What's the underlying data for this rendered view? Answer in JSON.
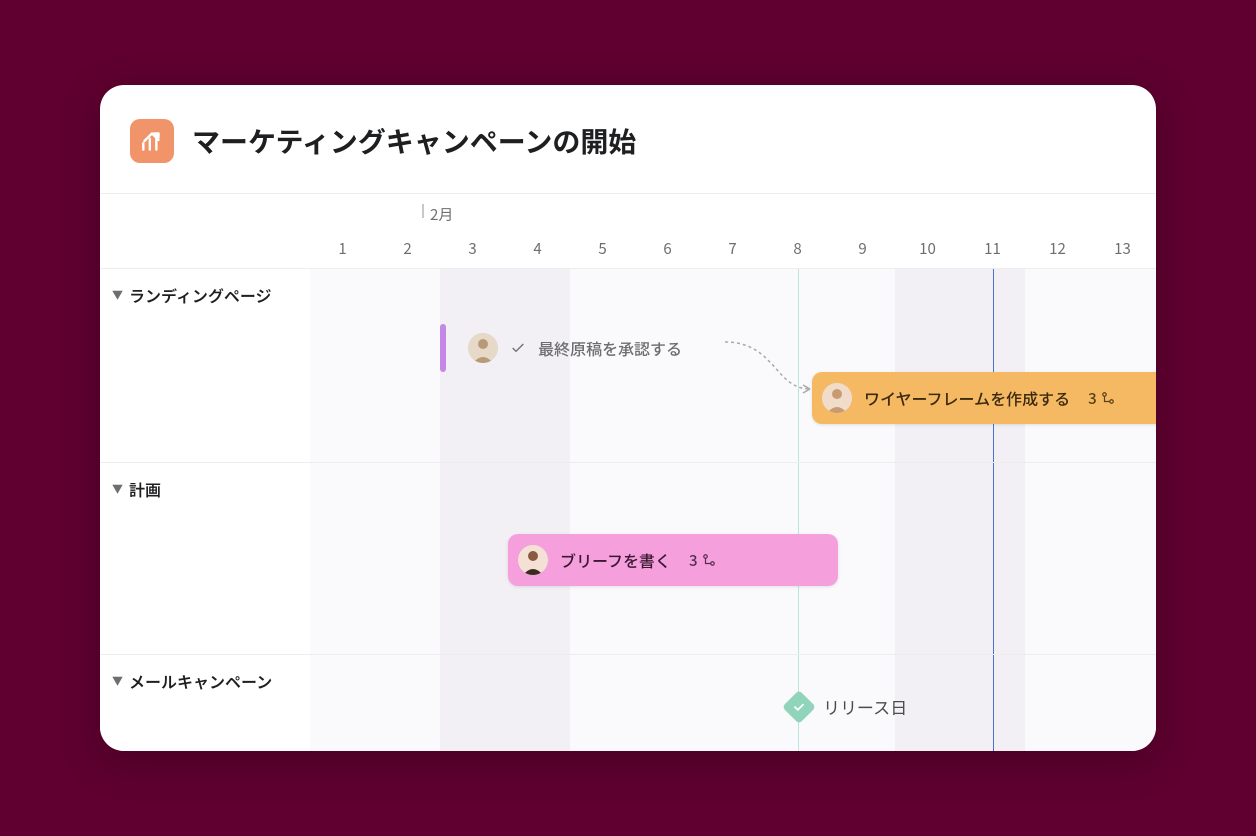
{
  "project": {
    "title": "マーケティングキャンペーンの開始",
    "icon": "chart-up-icon"
  },
  "timeline": {
    "month_label": "2月",
    "days": [
      1,
      2,
      3,
      4,
      5,
      6,
      7,
      8,
      9,
      10,
      11,
      12,
      13
    ],
    "weekend_indices": [
      2,
      3,
      9,
      10
    ],
    "today_index": 10
  },
  "sections": [
    {
      "name": "ランディングページ"
    },
    {
      "name": "計画"
    },
    {
      "name": "メールキャンペーン"
    }
  ],
  "tasks": {
    "approve_final": {
      "label": "最終原稿を承認する",
      "completed": true
    },
    "wireframe": {
      "label": "ワイヤーフレームを作成する",
      "subtask_count": "3"
    },
    "brief": {
      "label": "ブリーフを書く",
      "subtask_count": "3"
    }
  },
  "milestone": {
    "label": "リリース日"
  },
  "colors": {
    "accent_orange": "#f5b964",
    "accent_pink": "#f5a0dd",
    "milestone_green": "#8fd4bb",
    "today_blue": "#4573d2"
  }
}
